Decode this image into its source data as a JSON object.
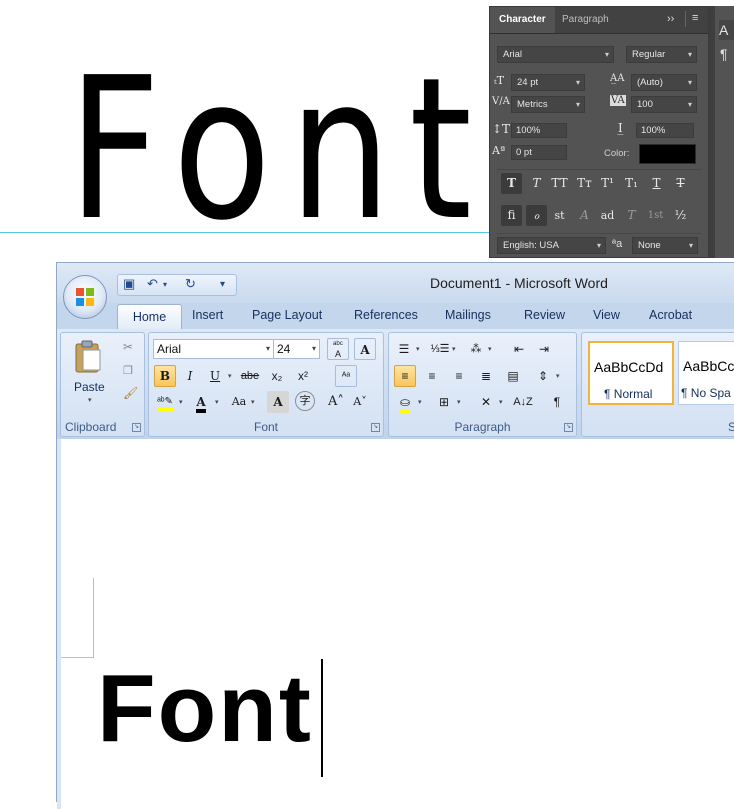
{
  "canvas": {
    "sample_text": "Font"
  },
  "photoshop": {
    "tabs": [
      "Character",
      "Paragraph"
    ],
    "font_family": "Arial",
    "font_style": "Regular",
    "font_size": "24 pt",
    "leading": "(Auto)",
    "kerning": "Metrics",
    "tracking": "100",
    "vertical_scale": "100%",
    "horizontal_scale": "100%",
    "baseline_shift": "0 pt",
    "color_label": "Color:",
    "color_value": "#000000",
    "style_buttons": [
      "T",
      "T",
      "TT",
      "Tт",
      "T¹",
      "T₁",
      "T",
      "T"
    ],
    "opentype_buttons": [
      "fi",
      "ℴ",
      "st",
      "A",
      "ad",
      "T",
      "1st",
      "½"
    ],
    "language": "English: USA",
    "aa_label": "ªa",
    "antialias": "None",
    "right_panel_letter": "A"
  },
  "word": {
    "title": "Document1 - Microsoft Word",
    "tabs": [
      "Home",
      "Insert",
      "Page Layout",
      "References",
      "Mailings",
      "Review",
      "View",
      "Acrobat"
    ],
    "clipboard": {
      "paste": "Paste",
      "label": "Clipboard"
    },
    "font": {
      "name": "Arial",
      "size": "24",
      "label": "Font"
    },
    "paragraph": {
      "label": "Paragraph"
    },
    "styles": {
      "normal_preview": "AaBbCcDd",
      "normal_name": "¶ Normal",
      "nospacing_preview": "AaBbCc",
      "nospacing_name": "¶ No Spa",
      "label_fragment": "S"
    },
    "document_text": "Font"
  }
}
